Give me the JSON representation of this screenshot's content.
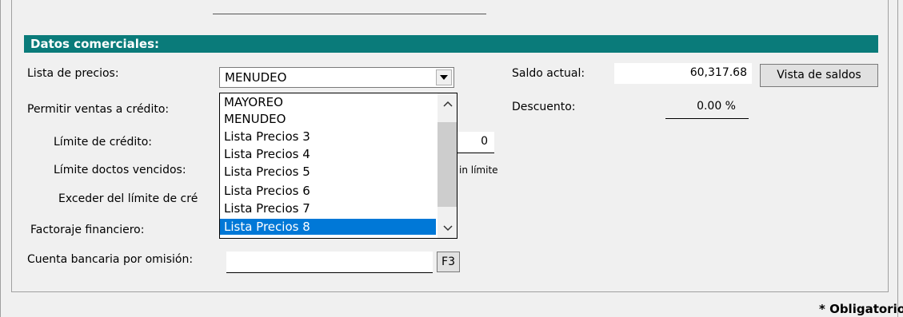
{
  "section": {
    "title": "Datos comerciales:"
  },
  "labels": {
    "lista_precios": "Lista de precios:",
    "permitir_credito": "Permitir ventas a crédito:",
    "limite_credito": "Límite de crédito:",
    "limite_doctos": "Límite doctos vencidos:",
    "exceder": "Exceder del límite de cré",
    "factoraje": "Factoraje financiero:",
    "cuenta_bancaria": "Cuenta bancaria por omisión:",
    "saldo_actual": "Saldo actual:",
    "descuento": "Descuento:"
  },
  "lista_precios": {
    "value": "MENUDEO",
    "options": [
      "MAYOREO",
      "MENUDEO",
      "Lista Precios 3",
      "Lista Precios 4",
      "Lista Precios 5",
      "Lista Precios 6",
      "Lista Precios 7",
      "Lista Precios 8"
    ],
    "highlighted": "Lista Precios 8"
  },
  "values": {
    "saldo_actual": "60,317.68",
    "descuento": "0.00 %",
    "limite_credito": "0",
    "sin_limite_fragment": "in límite",
    "cuenta_bancaria": ""
  },
  "buttons": {
    "vista_saldos": "Vista de saldos",
    "f3": "F3"
  },
  "footer": {
    "obligatorio": "* Obligatorio"
  }
}
